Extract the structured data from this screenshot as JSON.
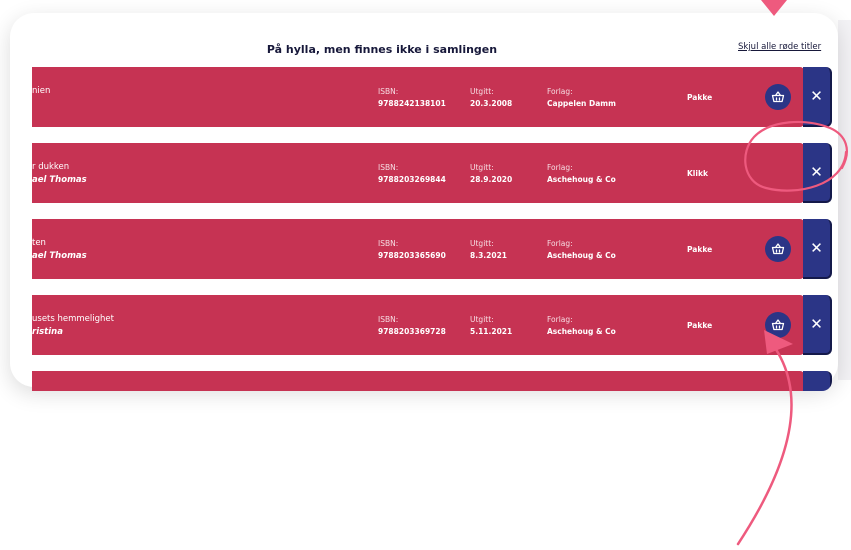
{
  "heading": "På hylla, men finnes ikke i samlingen",
  "hide_link": "Skjul alle røde titler",
  "labels": {
    "isbn": "ISBN:",
    "published": "Utgitt:",
    "publisher": "Forlag:"
  },
  "close_glyph": "✕",
  "rows": [
    {
      "title": "nien",
      "author": "",
      "isbn": "9788242138101",
      "published": "20.3.2008",
      "publisher": "Cappelen Damm",
      "type": "Pakke",
      "has_basket": true
    },
    {
      "title": "r dukken",
      "author": "ael Thomas",
      "isbn": "9788203269844",
      "published": "28.9.2020",
      "publisher": "Aschehoug & Co",
      "type": "Klikk",
      "has_basket": false
    },
    {
      "title": "ten",
      "author": "ael Thomas",
      "isbn": "9788203365690",
      "published": "8.3.2021",
      "publisher": "Aschehoug & Co",
      "type": "Pakke",
      "has_basket": true
    },
    {
      "title": "usets hemmelighet",
      "author": "ristina",
      "isbn": "9788203369728",
      "published": "5.11.2021",
      "publisher": "Aschehoug & Co",
      "type": "Pakke",
      "has_basket": true
    }
  ],
  "icons": {
    "basket": "basket-icon",
    "close": "close-icon"
  },
  "colors": {
    "row_red": "#c63353",
    "navy": "#2b3586",
    "annotation_pink": "#ee5a7e",
    "heading": "#17183a"
  }
}
